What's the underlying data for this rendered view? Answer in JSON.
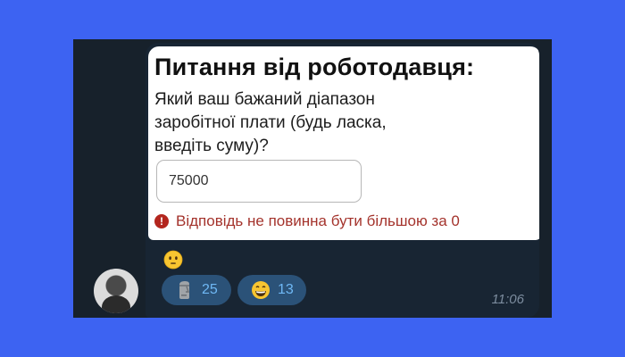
{
  "question": {
    "title": "Питання від роботодавця:",
    "text": "Який ваш бажаний діапазон заробітної плати (будь ласка, введіть суму)?",
    "input_value": "75000",
    "error_message": "Відповідь не повинна бути більшою за 0"
  },
  "message": {
    "caption_emoji": "flushed-face-emoji",
    "timestamp": "11:06"
  },
  "reactions": [
    {
      "emoji": "moai-emoji",
      "count": "25"
    },
    {
      "emoji": "grinning-face-emoji",
      "count": "13"
    }
  ],
  "colors": {
    "background": "#3d63f2",
    "chat_panel": "#17212b",
    "bubble": "#182533",
    "reaction_pill": "#2b5278",
    "reaction_count": "#6fb8f5",
    "error_red": "#b3261e"
  }
}
